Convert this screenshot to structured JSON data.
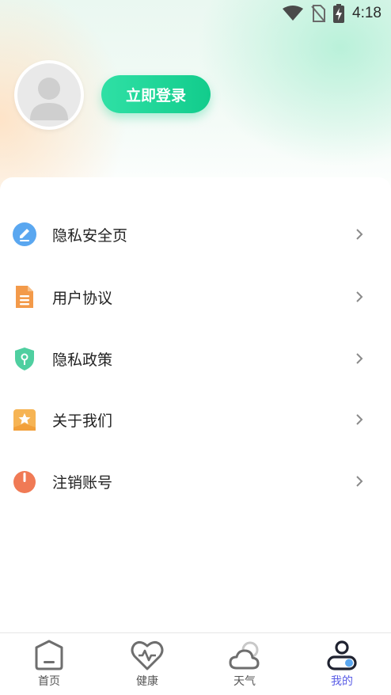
{
  "status_bar": {
    "time": "4:18"
  },
  "profile": {
    "login_label": "立即登录"
  },
  "menu": {
    "items": [
      {
        "label": "隐私安全页",
        "icon": "edit-icon",
        "color": "#5aa7f0"
      },
      {
        "label": "用户协议",
        "icon": "document-icon",
        "color": "#f39a4a"
      },
      {
        "label": "隐私政策",
        "icon": "shield-icon",
        "color": "#4fcfa0"
      },
      {
        "label": "关于我们",
        "icon": "star-badge-icon",
        "color": "#f6b454"
      },
      {
        "label": "注销账号",
        "icon": "power-icon",
        "color": "#f07a55"
      }
    ]
  },
  "tabbar": {
    "items": [
      {
        "label": "首页",
        "icon": "home-icon"
      },
      {
        "label": "健康",
        "icon": "heart-pulse-icon"
      },
      {
        "label": "天气",
        "icon": "weather-icon"
      },
      {
        "label": "我的",
        "icon": "profile-icon",
        "active": true
      }
    ],
    "active_color": "#5a5de6"
  }
}
